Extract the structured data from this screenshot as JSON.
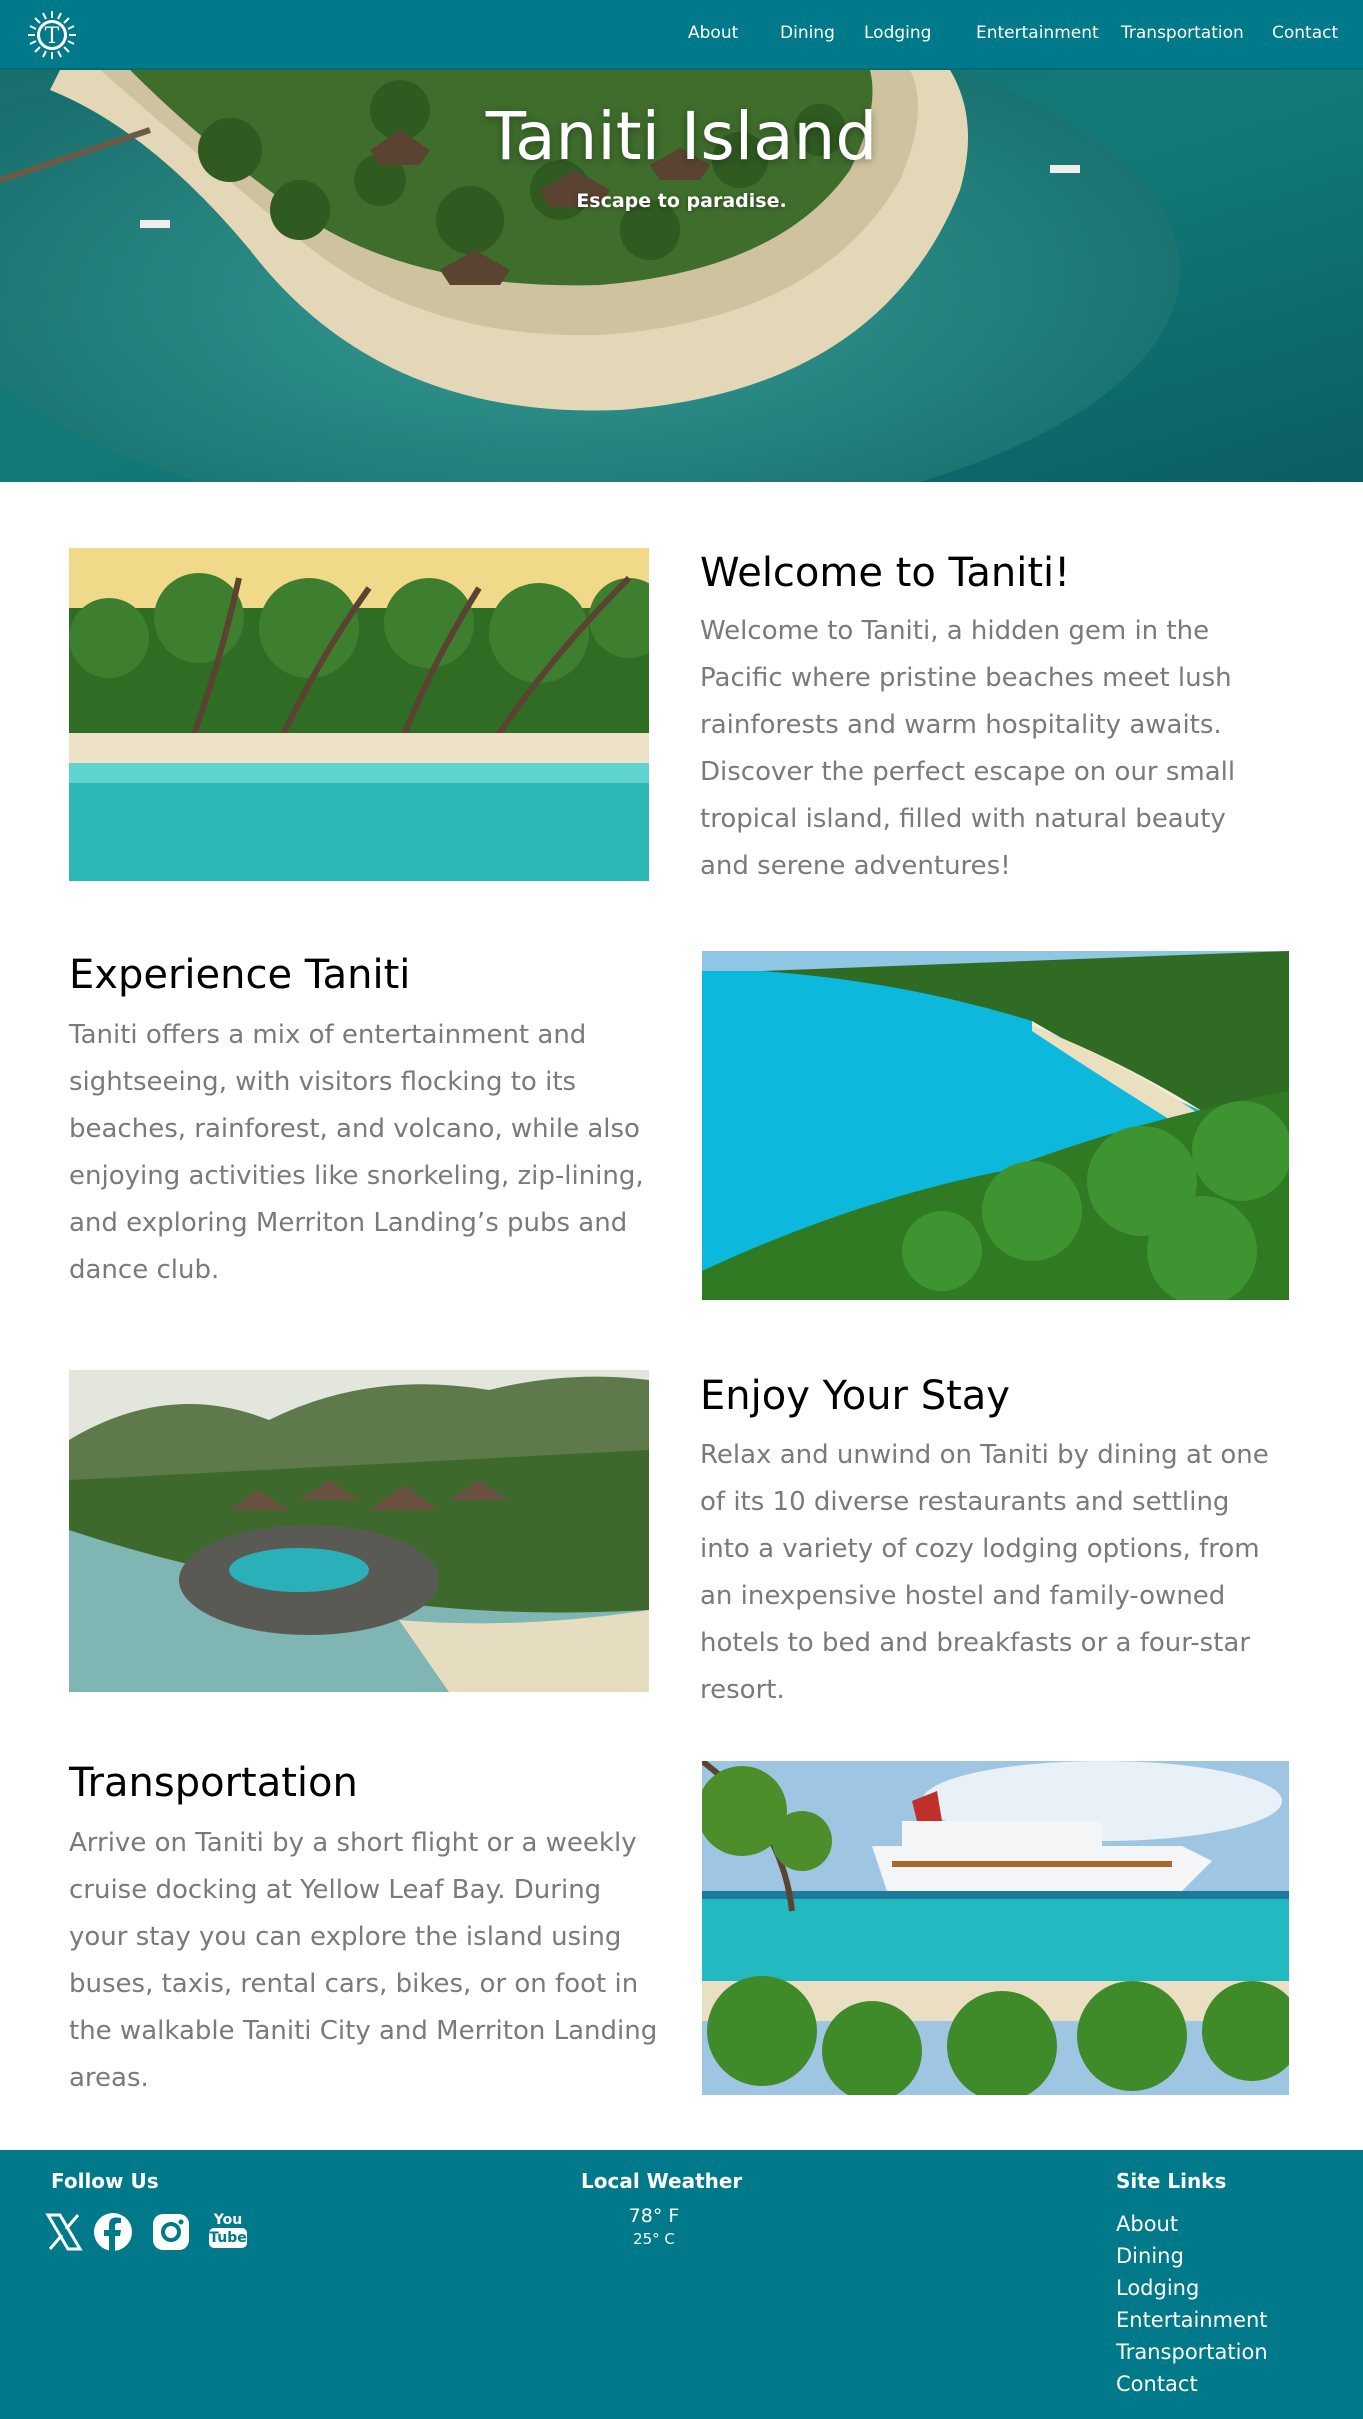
{
  "nav": {
    "items": [
      "About",
      "Dining",
      "Lodging",
      "Entertainment",
      "Transportation",
      "Contact"
    ]
  },
  "hero": {
    "title": "Taniti Island",
    "subtitle": "Escape to paradise."
  },
  "sections": [
    {
      "heading": "Welcome to Taniti!",
      "body": "Welcome to Taniti, a hidden gem in the Pacific where pristine beaches meet lush rainforests and warm hospitality awaits. Discover the perfect escape on our small tropical island, filled with natural beauty and serene adventures!"
    },
    {
      "heading": "Experience Taniti",
      "body": "Taniti offers a mix of entertainment and sightseeing, with visitors flocking to its beaches, rainforest, and volcano, while also enjoying activities like snorkeling, zip-lining, and exploring Merriton Landing’s pubs and dance club."
    },
    {
      "heading": "Enjoy Your Stay",
      "body": "Relax and unwind on Taniti by dining at one of its 10 diverse restaurants and settling into a variety of cozy lodging options, from an inexpensive hostel and family-owned hotels to bed and breakfasts or a four-star resort."
    },
    {
      "heading": "Transportation",
      "body": "Arrive on Taniti by a short flight or a weekly cruise docking at Yellow Leaf Bay. During your stay you can explore the island using buses, taxis, rental cars, bikes, or on foot in the walkable Taniti City and Merriton Landing areas."
    }
  ],
  "footer": {
    "follow_title": "Follow Us",
    "social_icons": [
      "x-icon",
      "facebook-icon",
      "instagram-icon",
      "youtube-icon"
    ],
    "youtube_text_top": "You",
    "youtube_text_bottom": "Tube",
    "weather_title": "Local Weather",
    "temp_f": "78° F",
    "temp_c": "25° C",
    "links_title": "Site Links",
    "links": [
      "About",
      "Dining",
      "Lodging",
      "Entertainment",
      "Transportation",
      "Contact"
    ]
  },
  "colors": {
    "brand_teal": "#00798a",
    "body_gray": "#7a7a7a"
  }
}
